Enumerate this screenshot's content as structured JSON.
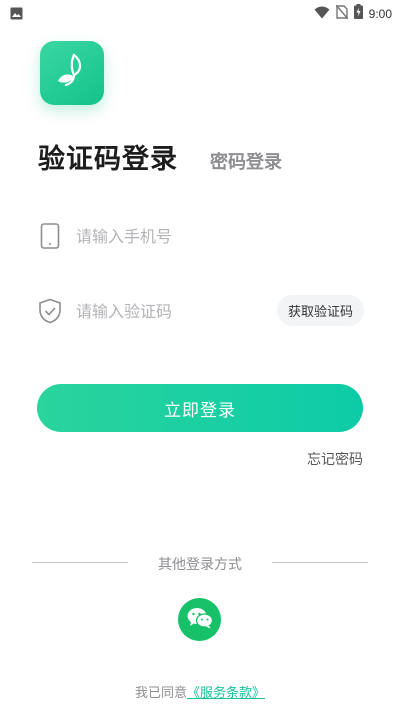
{
  "status_bar": {
    "time": "9:00",
    "left_icon": "image-icon",
    "right_icons": [
      "wifi-icon",
      "no-sim-icon",
      "battery-charging-icon"
    ]
  },
  "logo": {
    "icon": "leaf-icon",
    "color": "#1fcb92"
  },
  "tabs": {
    "active": "验证码登录",
    "inactive": "密码登录"
  },
  "phone_field": {
    "icon": "phone-icon",
    "placeholder": "请输入手机号",
    "value": ""
  },
  "code_field": {
    "icon": "shield-check-icon",
    "placeholder": "请输入验证码",
    "value": "",
    "get_code_label": "获取验证码"
  },
  "login_button": {
    "label": "立即登录",
    "gradient": [
      "#2ad49c",
      "#0dcba8"
    ]
  },
  "forgot_password": "忘记密码",
  "other_login": {
    "label": "其他登录方式",
    "methods": [
      {
        "icon": "wechat-icon",
        "color": "#17c16a"
      }
    ]
  },
  "agreement": {
    "prefix": "我已同意",
    "link": "《服务条款》"
  }
}
